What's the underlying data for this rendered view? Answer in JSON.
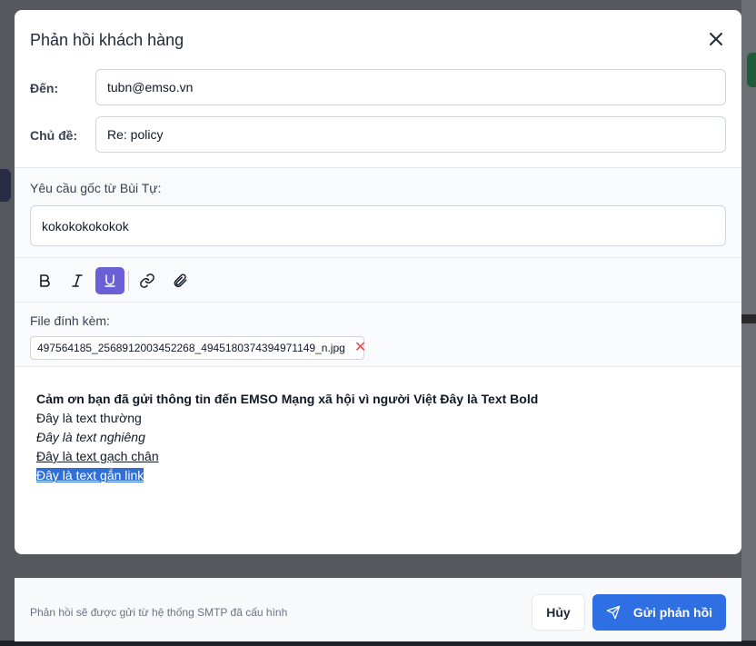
{
  "modal": {
    "title": "Phản hồi khách hàng",
    "to_label": "Đến:",
    "to_value": "tubn@emso.vn",
    "subject_label": "Chủ đề:",
    "subject_value": "Re: policy",
    "original_label": "Yêu cầu gốc từ Bùi Tự:",
    "original_text": "kokokokokokok"
  },
  "toolbar": {
    "bold": "B",
    "italic": "I",
    "underline": "U",
    "active": "underline",
    "icons": [
      "bold-icon",
      "italic-icon",
      "underline-icon",
      "link-icon",
      "paperclip-icon"
    ]
  },
  "attachments": {
    "label": "File đính kèm:",
    "files": [
      "497564185_2568912003452268_4945180374394971149_n.jpg"
    ]
  },
  "editor": {
    "line1_parts": [
      "Cảm ơn bạn đã gửi thông tin đến EMSO Mạng xã hội vì người Việt",
      " Đây là Text Bold"
    ],
    "line2": "Đây là text thường",
    "line3": "Đây là text nghiêng",
    "line4": "Đây là text gạch chân",
    "line5": "Đây là text gắn link"
  },
  "footer": {
    "note": "Phản hồi sẽ được gửi từ hệ thống SMTP đã cấu hình",
    "cancel_label": "Hủy",
    "send_label": "Gửi phản hồi"
  },
  "colors": {
    "primary": "#2f6fe4",
    "active_toolbar": "#6b5fd6",
    "remove": "#ef4444",
    "link_highlight": "#2f6fd6"
  }
}
